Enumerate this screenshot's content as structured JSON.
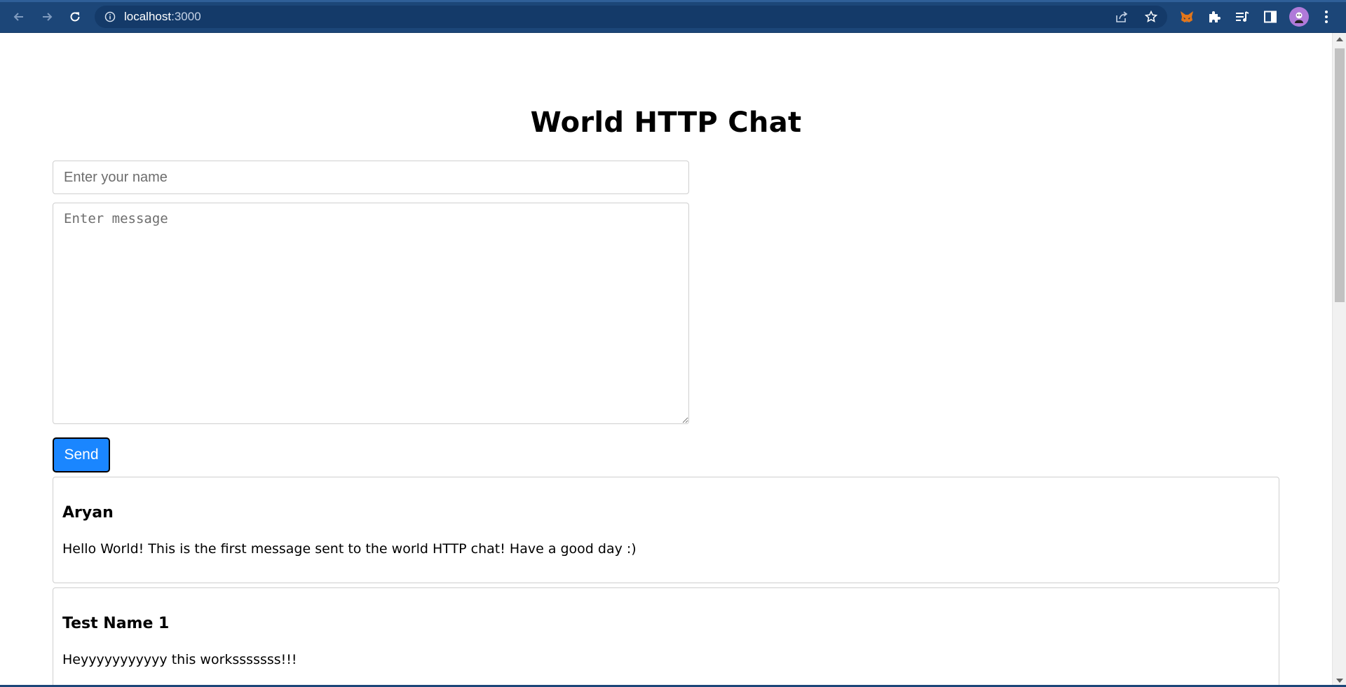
{
  "browser": {
    "url_host": "localhost",
    "url_port": ":3000",
    "icons": {
      "back": "arrow-left-icon",
      "forward": "arrow-right-icon",
      "reload": "reload-icon",
      "site_info": "info-icon",
      "share": "share-icon",
      "bookmark": "star-icon",
      "metamask": "fox-extension-icon",
      "extensions": "puzzle-icon",
      "reading_list": "queue-music-icon",
      "side_panel": "side-panel-icon",
      "profile": "avatar-icon",
      "menu": "kebab-menu-icon"
    },
    "colors": {
      "chrome": "#1c4678",
      "omnibox": "#143a69"
    }
  },
  "page": {
    "title": "World HTTP Chat",
    "name_input": {
      "placeholder": "Enter your name",
      "value": ""
    },
    "message_input": {
      "placeholder": "Enter message",
      "value": ""
    },
    "send_label": "Send",
    "accent": "#1a86ff",
    "messages": [
      {
        "author": "Aryan",
        "text": "Hello World! This is the first message sent to the world HTTP chat! Have a good day :)"
      },
      {
        "author": "Test Name 1",
        "text": "Heyyyyyyyyyyy this worksssssss!!!"
      }
    ]
  }
}
